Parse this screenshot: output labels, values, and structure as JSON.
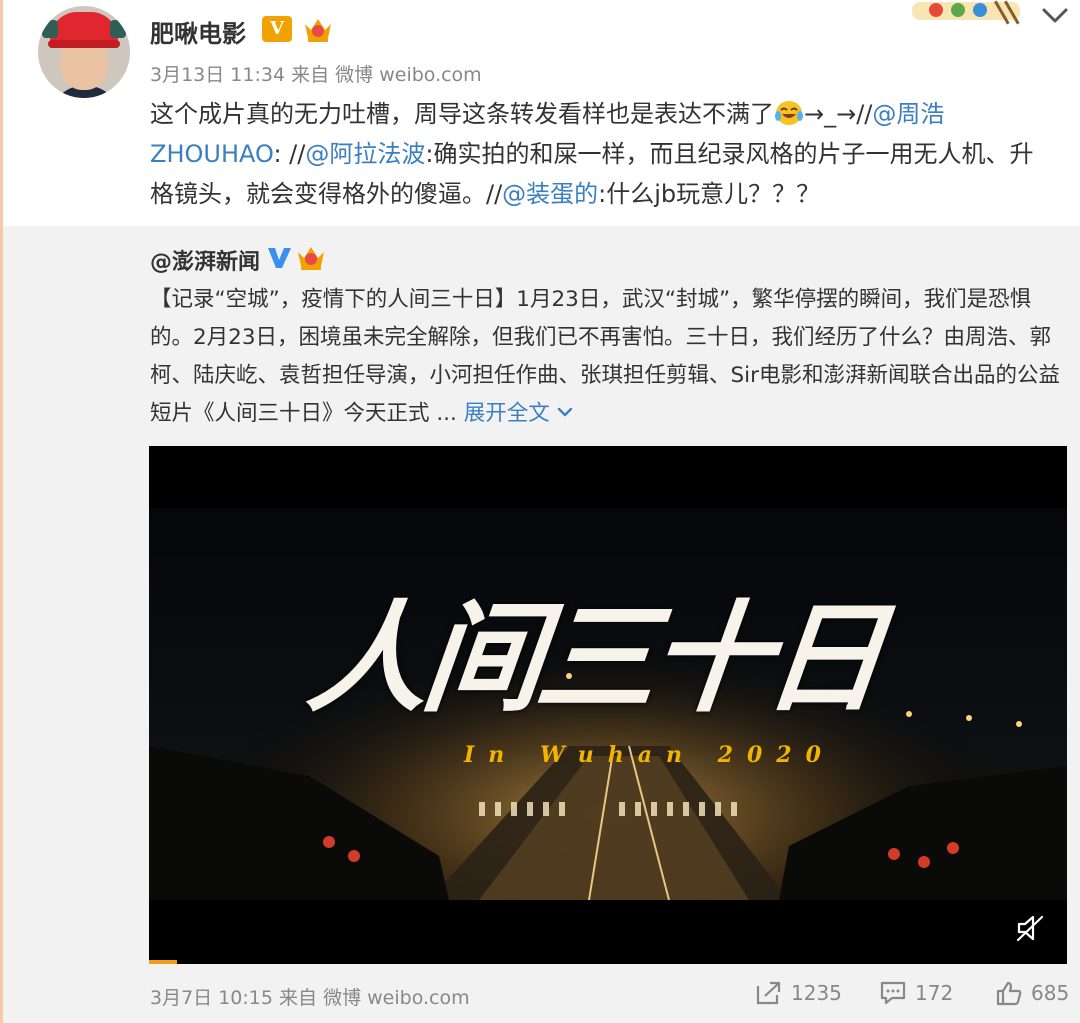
{
  "post": {
    "username": "肥啾电影",
    "verified_badge": "V",
    "date": "3月13日 11:34",
    "source_prefix": "来自",
    "source": "微博 weibo.com",
    "text_part1": "这个成片真的无力吐槽，周导这条转发看样也是表达不满了",
    "text_arrow": "→_→//",
    "mention1": "@周浩ZHOUHAO",
    "text_part2": ": //",
    "mention2": "@阿拉法波",
    "text_part3": ":确实拍的和屎一样，而且纪录风格的片子一用无人机、升格镜头，就会变得格外的傻逼。//",
    "mention3": "@装蛋的",
    "text_part4": ":什么jb玩意儿？？？"
  },
  "repost": {
    "username": "@澎湃新闻",
    "text": "【记录“空城”，疫情下的人间三十日】1月23日，武汉“封城”，繁华停摆的瞬间，我们是恐惧的。2月23日，困境虽未完全解除，但我们已不再害怕。三十日，我们经历了什么？由周浩、郭柯、陆庆屹、袁哲担任导演，小河担任作曲、张琪担任剪辑、Sir电影和澎湃新闻联合出品的公益短片《人间三十日》今天正式 ...",
    "expand_label": "展开全文",
    "video": {
      "title": "人间三十日",
      "subtitle": "In Wuhan 2020",
      "progress_fraction": 0.03
    },
    "date": "3月7日 10:15",
    "source_prefix": "来自",
    "source": "微博 weibo.com",
    "repost_count": "1235",
    "comment_count": "172",
    "like_count": "685"
  },
  "colors": {
    "link": "#3a7fc1",
    "meta": "#888888",
    "badge": "#f2a200",
    "progress": "#f59c1b"
  },
  "icons": [
    "chevron-down-icon",
    "verified-v-icon",
    "crown-icon",
    "laugh-cry-emoji-icon",
    "mute-icon",
    "repost-icon",
    "comment-icon",
    "like-icon"
  ]
}
